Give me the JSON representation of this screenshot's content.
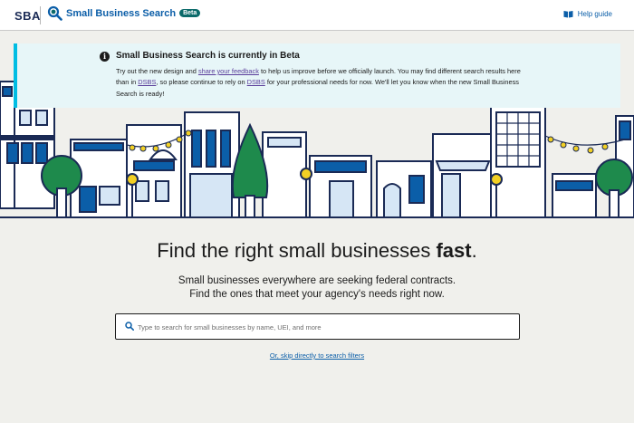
{
  "header": {
    "logo_text": "SBA",
    "app_title": "Small Business Search",
    "beta_badge": "Beta",
    "help_label": "Help guide"
  },
  "alert": {
    "title": "Small Business Search is currently in Beta",
    "text_1": "Try out the new design and ",
    "link_feedback": "share your feedback",
    "text_2": " to help us improve before we officially launch. You may find different search results here than in ",
    "link_dsbs_1": "DSBS",
    "text_3": ", so please continue to rely on ",
    "link_dsbs_2": "DSBS",
    "text_4": " for your professional needs for now. We'll let you know when the new Small Business Search is ready!"
  },
  "hero": {
    "title_prefix": "Find the right small businesses ",
    "title_emphasis": "fast",
    "title_suffix": ".",
    "subtitle_line1": "Small businesses everywhere are seeking federal contracts.",
    "subtitle_line2": "Find the ones that meet your agency's needs right now."
  },
  "search": {
    "placeholder": "Type to search for small businesses by name, UEI, and more",
    "value": ""
  },
  "skip_link": "Or, skip directly to search filters",
  "colors": {
    "brand_blue": "#0b5ea8",
    "navy": "#1a2a55",
    "alert_bg": "#e7f6f8",
    "alert_border": "#00bde3",
    "tree_green": "#1e8a4c",
    "lamp_yellow": "#f2d024",
    "page_bg": "#f0f0ec"
  }
}
